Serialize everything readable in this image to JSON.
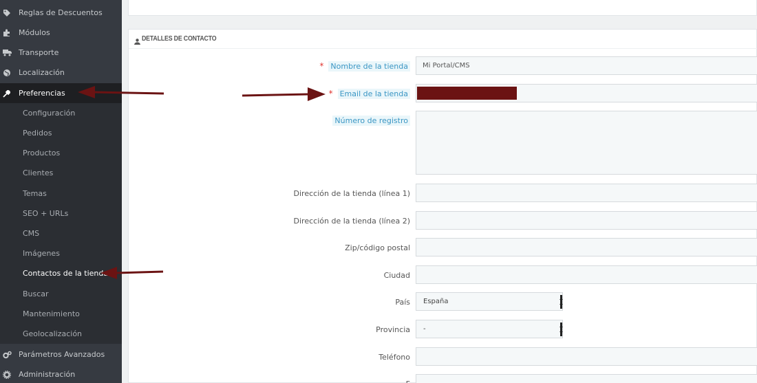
{
  "sidebar": {
    "items": [
      {
        "label": "Reglas de Descuentos",
        "icon": "tag-icon"
      },
      {
        "label": "Módulos",
        "icon": "puzzle-icon"
      },
      {
        "label": "Transporte",
        "icon": "truck-icon"
      },
      {
        "label": "Localización",
        "icon": "globe-icon"
      },
      {
        "label": "Preferencias",
        "icon": "wrench-icon"
      },
      {
        "label": "Parámetros Avanzados",
        "icon": "cogs-icon"
      },
      {
        "label": "Administración",
        "icon": "gear-icon"
      }
    ],
    "submenu": [
      "Configuración",
      "Pedidos",
      "Productos",
      "Clientes",
      "Temas",
      "SEO + URLs",
      "CMS",
      "Imágenes",
      "Contactos de la tienda",
      "Buscar",
      "Mantenimiento",
      "Geolocalización"
    ]
  },
  "panel": {
    "title": "DETALLES DE CONTACTO",
    "fields": {
      "shop_name_label": "Nombre de la tienda",
      "shop_name_value": "Mi Portal/CMS",
      "shop_email_label": "Email de la tienda",
      "registration_label": "Número de registro",
      "address1_label": "Dirección de la tienda (línea 1)",
      "address2_label": "Dirección de la tienda (línea 2)",
      "zip_label": "Zip/código postal",
      "city_label": "Ciudad",
      "country_label": "País",
      "country_value": "España",
      "state_label": "Provincia",
      "state_value": "-",
      "phone_label": "Teléfono",
      "fax_label_partial": "F"
    },
    "required_mark": "*"
  },
  "colors": {
    "sidebar_bg": "#363a41",
    "submenu_bg": "#2b2e33",
    "annotation_arrow": "#6b1313",
    "hint_label_bg": "#eaf6fa",
    "hint_label_text": "#3a96c4",
    "required": "#e0342f"
  }
}
